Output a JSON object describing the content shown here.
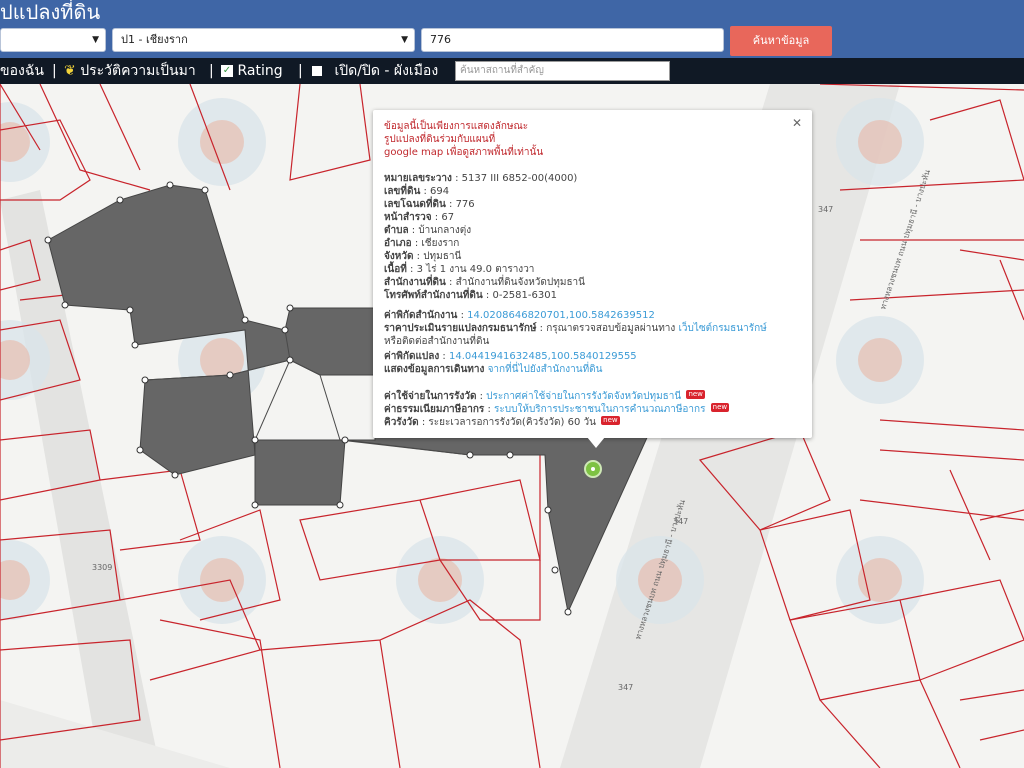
{
  "header": {
    "title": "ปแปลงที่ดิน",
    "province_select": "",
    "district_select": "ป1 - เชียงราก",
    "deed_input": "776",
    "search_button": "ค้นหาข้อมูล"
  },
  "toolbar": {
    "item1": "ของฉัน",
    "item2": "ประวัติความเป็นมา",
    "item3": "Rating",
    "item4": "เปิด/ปิด - ผังเมือง",
    "search_placeholder": "ค้นหาสถานที่สำคัญ"
  },
  "popup": {
    "notice1": "ข้อมูลนี้เป็นเพียงการแสดงลักษณะ",
    "notice2": "รูปแปลงที่ดินร่วมกับแผนที่",
    "notice3": "google map เพื่อดูสภาพพื้นที่เท่านั้น",
    "rows": [
      {
        "label": "หมายเลขระวาง",
        "value": "5137 III 6852-00(4000)"
      },
      {
        "label": "เลขที่ดิน",
        "value": "694"
      },
      {
        "label": "เลขโฉนดที่ดิน",
        "value": "776"
      },
      {
        "label": "หน้าสำรวจ",
        "value": "67"
      },
      {
        "label": "ตำบล",
        "value": "บ้านกลางตุ่ง"
      },
      {
        "label": "อำเภอ",
        "value": "เชียงราก"
      },
      {
        "label": "จังหวัด",
        "value": "ปทุมธานี"
      },
      {
        "label": "เนื้อที่",
        "value": "3 ไร่ 1 งาน 49.0 ตารางวา"
      },
      {
        "label": "สำนักงานที่ดิน",
        "value": "สำนักงานที่ดินจังหวัดปทุมธานี"
      },
      {
        "label": "โทรศัพท์สำนักงานที่ดิน",
        "value": "0-2581-6301"
      }
    ],
    "office_coord_label": "ค่าพิกัดสำนักงาน",
    "office_coord_value": "14.0208646820701,100.5842639512",
    "appraisal_label": "ราคาประเมินรายแปลงกรมธนารักษ์",
    "appraisal_text": "กรุณาตรวจสอบข้อมูลผ่านทาง",
    "appraisal_link": "เว็บไซต์กรมธนารักษ์",
    "appraisal_text2": "หรือติดต่อสำนักงานที่ดิน",
    "parcel_coord_label": "ค่าพิกัดแปลง",
    "parcel_coord_value": "14.0441941632485,100.5840129555",
    "route_label": "แสดงข้อมูลการเดินทาง",
    "route_link": "จากที่นี่ไปยังสำนักงานที่ดิน",
    "fee_label": "ค่าใช้จ่ายในการรังวัด",
    "fee_link": "ประกาศค่าใช้จ่ายในการรังวัดจังหวัดปทุมธานี",
    "tax_label": "ค่าธรรมเนียมภาษีอากร",
    "tax_link": "ระบบให้บริการประชาชนในการคำนวณภาษีอากร",
    "survey_label": "คิวรังวัด",
    "survey_text": "ระยะเวลารอการรังวัด(คิวรังวัด) 60 วัน",
    "new_badge": "new"
  },
  "map": {
    "road_labels": [
      "347",
      "347",
      "347",
      "3309"
    ],
    "road_names": [
      "ทางหลวงชนบท ถนน ปทุมธานี - บางปะหัน",
      "ทางหลวงชนบท ถนน ปทุมธานี - บางปะหัน"
    ]
  },
  "colors": {
    "header": "#3f66a6",
    "toolbar": "#101925",
    "button": "#e8675b",
    "parcel": "#666666",
    "lines": "#c8242c",
    "marker": "#7dc243"
  }
}
